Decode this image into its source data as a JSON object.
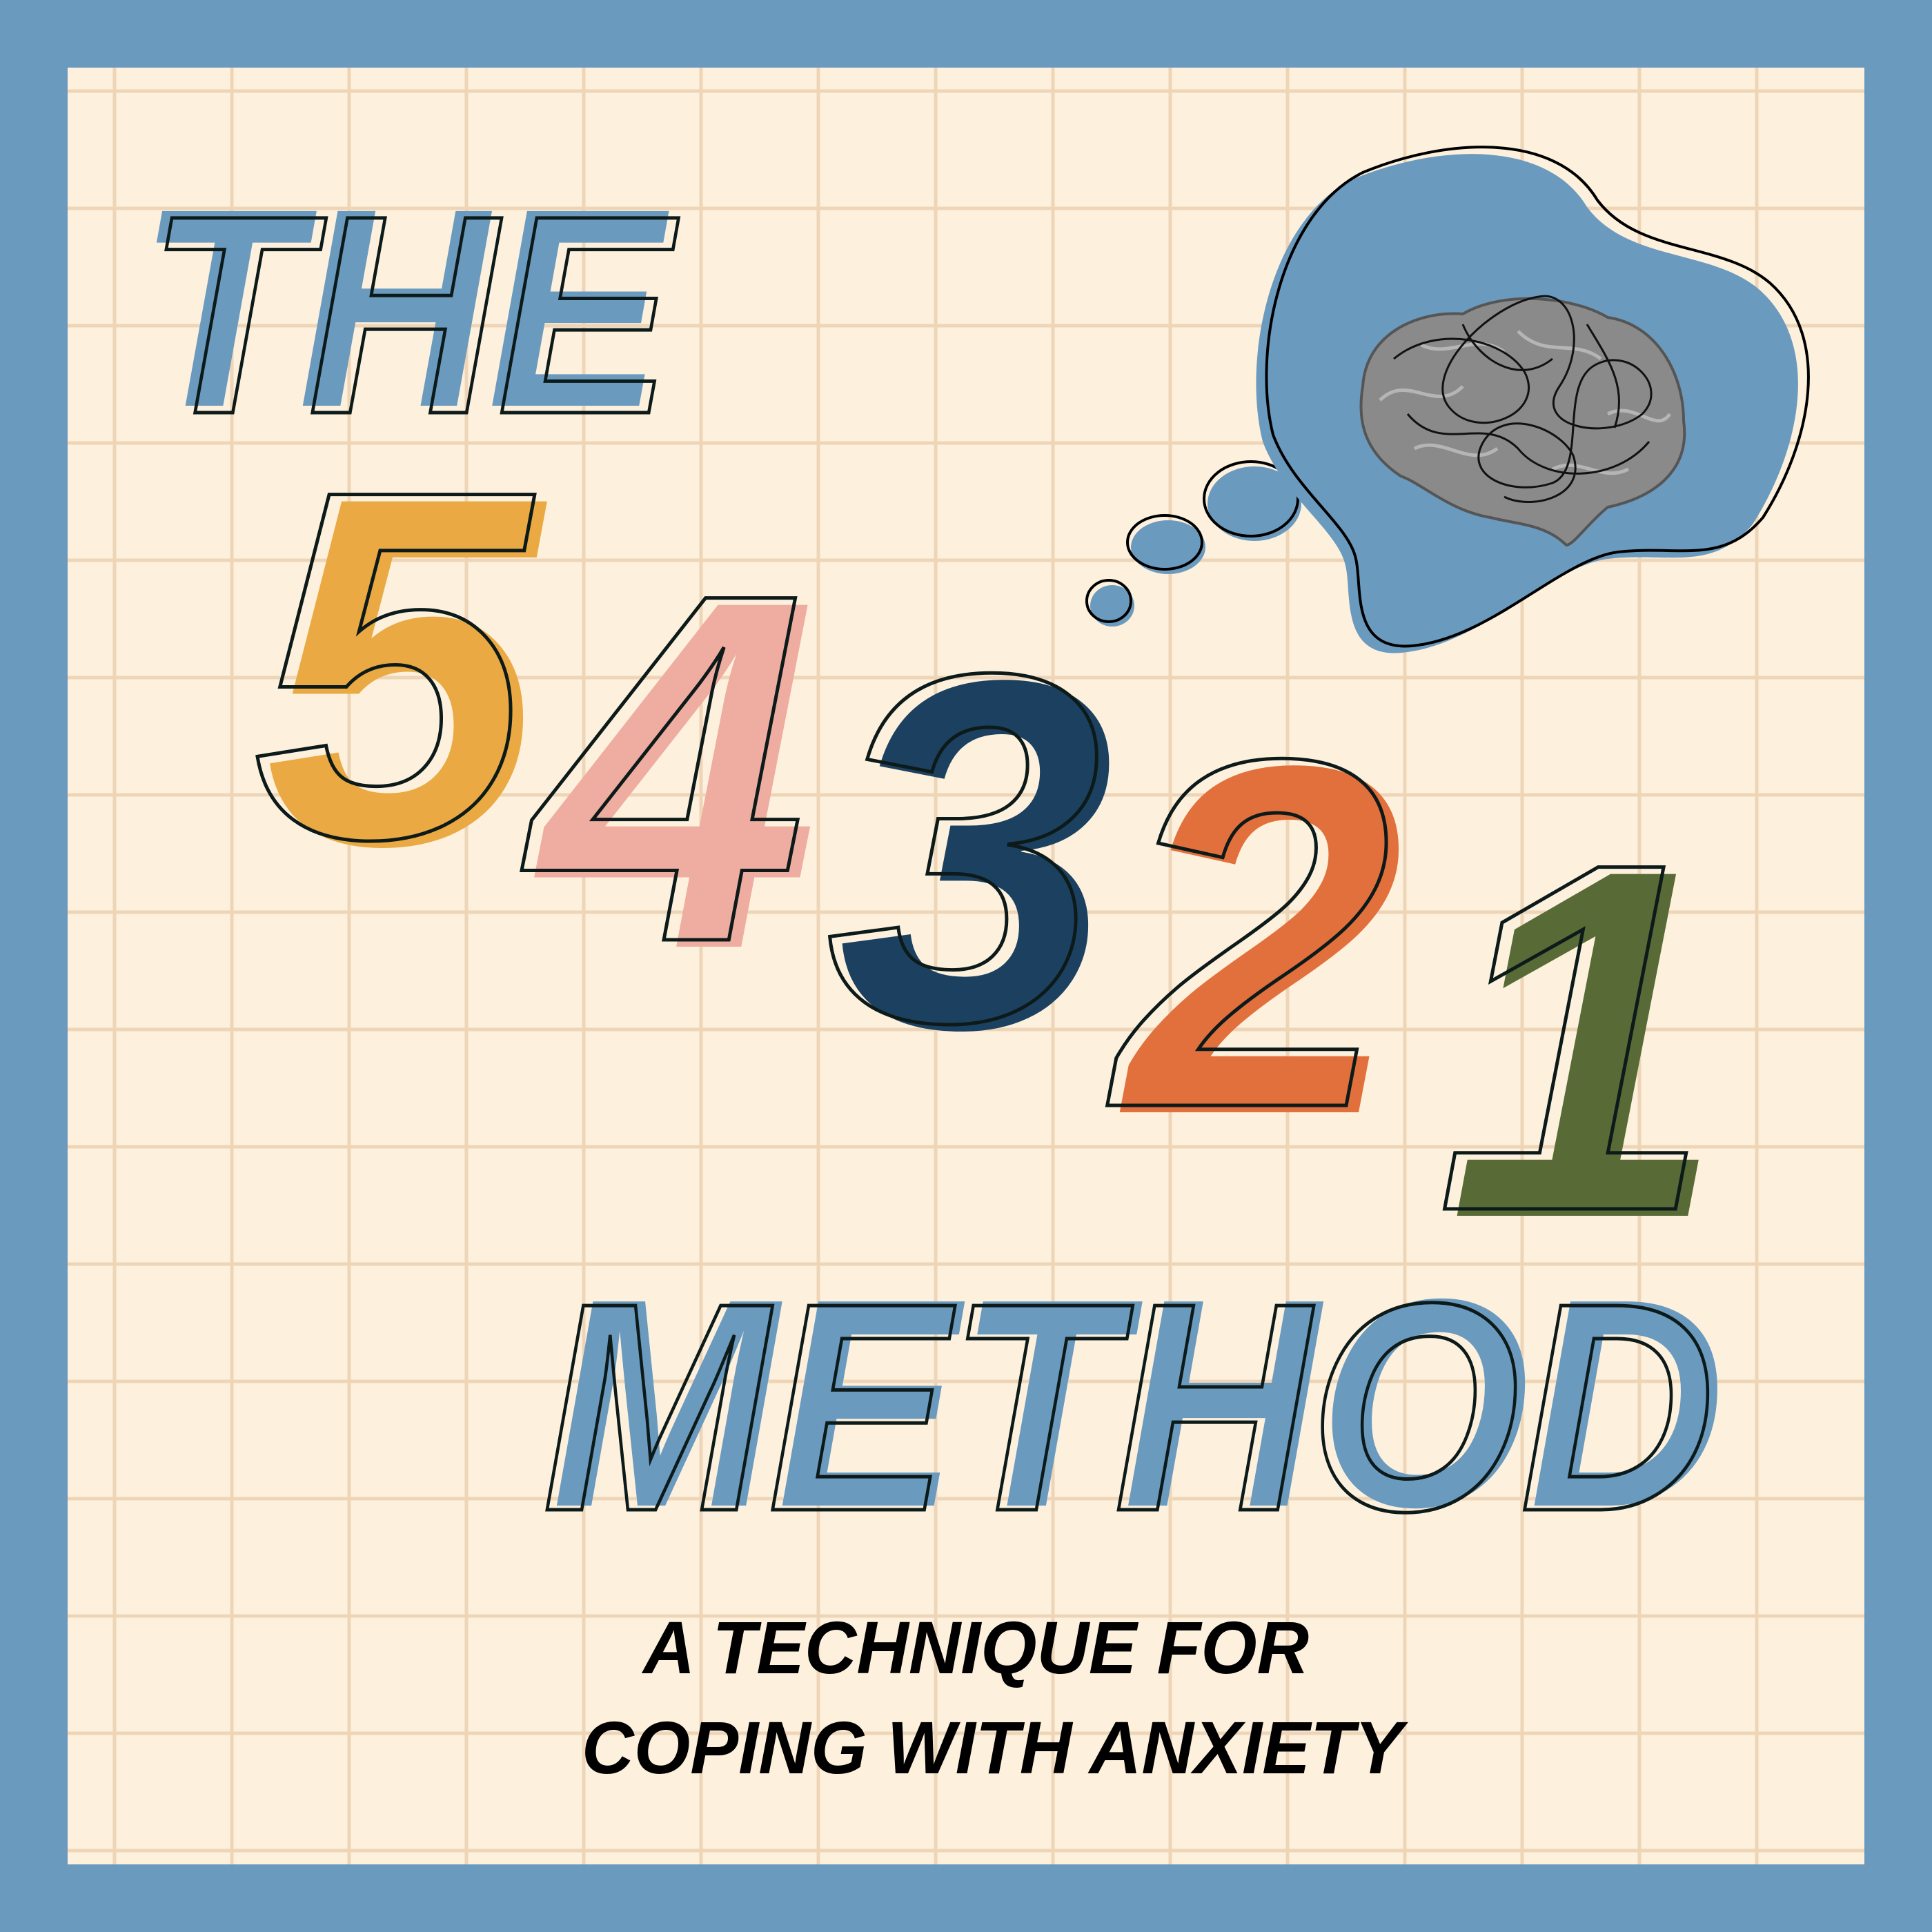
{
  "title": {
    "the": "THE",
    "digits": [
      "5",
      "4",
      "3",
      "2",
      "1"
    ],
    "method": "METHOD"
  },
  "subtitle": {
    "line1": "A TECHNIQUE FOR",
    "line2": "COPING WITH ANXIETY"
  },
  "illustration": {
    "icon": "brain-thought-bubble-icon"
  },
  "colors": {
    "border": "#6b9abf",
    "paper": "#fdf1dd",
    "grid": "#efd5b8",
    "title_blue": "#6b9abf",
    "digit_5": "#eaa942",
    "digit_4": "#eeada0",
    "digit_3": "#1c4160",
    "digit_2": "#e2703c",
    "digit_1": "#586a36",
    "outline": "#0d1a1a"
  }
}
